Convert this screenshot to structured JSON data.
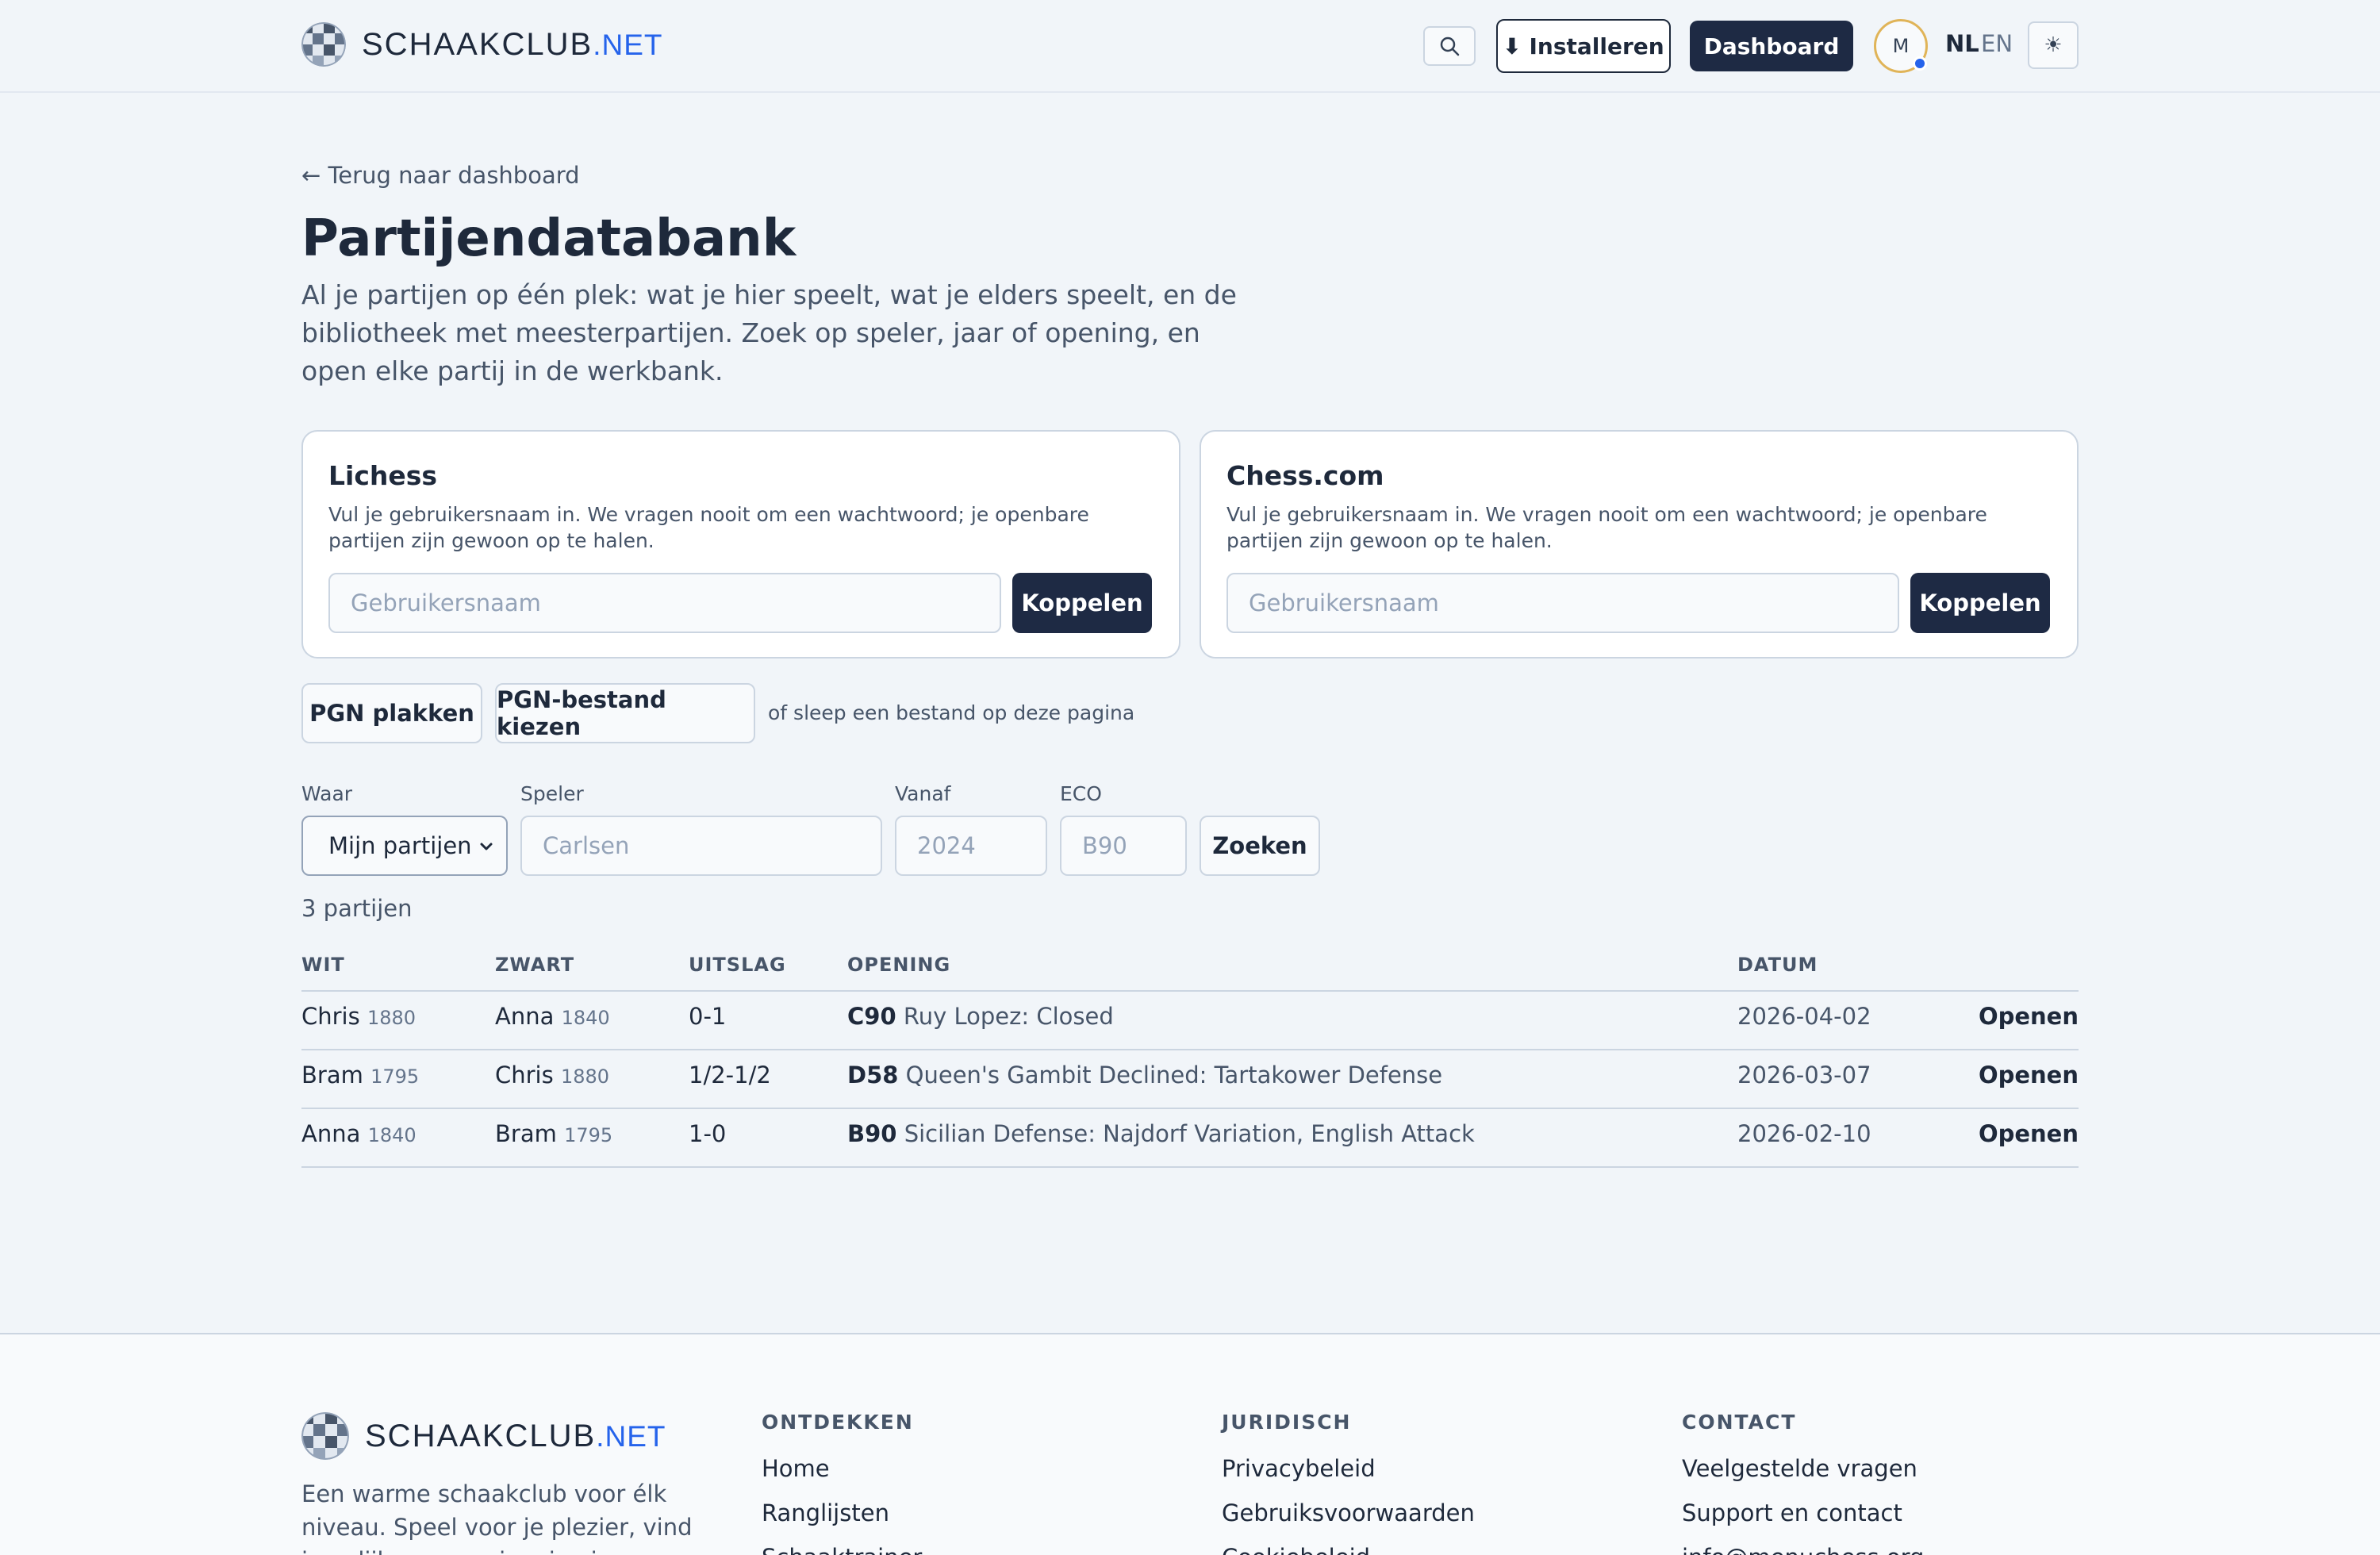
{
  "header": {
    "brand_name": "SCHAAKCLUB",
    "brand_tld": ".NET",
    "install_label": "⬇ Installeren",
    "dashboard_label": "Dashboard",
    "avatar_initial": "M",
    "lang_active": "NL",
    "lang_other": "EN",
    "theme_icon": "☀"
  },
  "page": {
    "back_link": "← Terug naar dashboard",
    "title": "Partijendatabank",
    "intro": "Al je partijen op één plek: wat je hier speelt, wat je elders speelt, en de bibliotheek met meesterpartijen. Zoek op speler, jaar of opening, en open elke partij in de werkbank."
  },
  "connect": {
    "lichess": {
      "title": "Lichess",
      "desc": "Vul je gebruikersnaam in. We vragen nooit om een wachtwoord; je openbare partijen zijn gewoon op te halen.",
      "placeholder": "Gebruikersnaam",
      "button": "Koppelen"
    },
    "chesscom": {
      "title": "Chess.com",
      "desc": "Vul je gebruikersnaam in. We vragen nooit om een wachtwoord; je openbare partijen zijn gewoon op te halen.",
      "placeholder": "Gebruikersnaam",
      "button": "Koppelen"
    }
  },
  "pgn": {
    "paste_label": "PGN plakken",
    "file_label": "PGN-bestand kiezen",
    "hint": "of sleep een bestand op deze pagina"
  },
  "filters": {
    "where_label": "Waar",
    "where_value": "Mijn partijen",
    "player_label": "Speler",
    "player_placeholder": "Carlsen",
    "from_label": "Vanaf",
    "from_placeholder": "2024",
    "eco_label": "ECO",
    "eco_placeholder": "B90",
    "search_label": "Zoeken"
  },
  "results": {
    "count": "3 partijen",
    "columns": [
      "WIT",
      "ZWART",
      "UITSLAG",
      "OPENING",
      "DATUM"
    ],
    "rows": [
      {
        "white": "Chris",
        "white_elo": "1880",
        "black": "Anna",
        "black_elo": "1840",
        "result": "0-1",
        "eco": "C90",
        "opening": "Ruy Lopez: Closed",
        "date": "2026-04-02",
        "action": "Openen"
      },
      {
        "white": "Bram",
        "white_elo": "1795",
        "black": "Chris",
        "black_elo": "1880",
        "result": "1/2-1/2",
        "eco": "D58",
        "opening": "Queen's Gambit Declined: Tartakower Defense",
        "date": "2026-03-07",
        "action": "Openen"
      },
      {
        "white": "Anna",
        "white_elo": "1840",
        "black": "Bram",
        "black_elo": "1795",
        "result": "1-0",
        "eco": "B90",
        "opening": "Sicilian Defense: Najdorf Variation, English Attack",
        "date": "2026-02-10",
        "action": "Openen"
      }
    ]
  },
  "footer": {
    "brand_name": "SCHAAKCLUB",
    "brand_tld": ".NET",
    "tagline": "Een warme schaakclub voor élk niveau. Speel voor je plezier, vind je gelijke en groei op je eigen tempo.",
    "col1": {
      "heading": "ONTDEKKEN",
      "links": [
        "Home",
        "Ranglijsten",
        "Schaaktrainer"
      ]
    },
    "col2": {
      "heading": "JURIDISCH",
      "links": [
        "Privacybeleid",
        "Gebruiksvoorwaarden",
        "Cookiebeleid"
      ]
    },
    "col3": {
      "heading": "CONTACT",
      "links": [
        "Veelgestelde vragen",
        "Support en contact",
        "info@menuchess.org"
      ]
    }
  },
  "colors": {
    "primary_dark": "#1e2a44",
    "accent_blue": "#2563eb",
    "background": "#f1f5f9",
    "avatar_ring": "#e0b458"
  }
}
